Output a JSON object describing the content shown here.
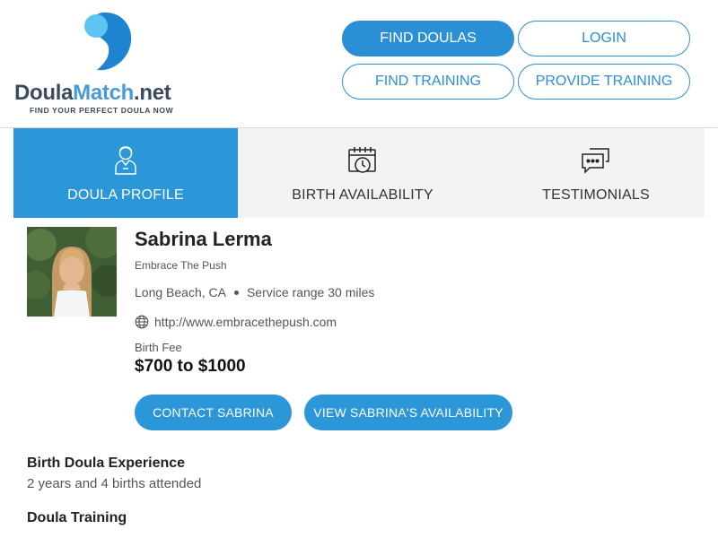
{
  "brand": {
    "name_part1": "Doula",
    "name_part2": "Match",
    "name_part3": ".net",
    "tagline": "FIND YOUR PERFECT DOULA NOW",
    "colors": {
      "primary": "#2b96d8",
      "logo_light": "#5ec4f2",
      "logo_dark": "#1f84d0",
      "text_dark": "#3b4a5c"
    }
  },
  "nav": {
    "find_doulas": "FIND DOULAS",
    "login": "LOGIN",
    "find_training": "FIND TRAINING",
    "provide_training": "PROVIDE TRAINING"
  },
  "tabs": [
    {
      "label": "DOULA PROFILE",
      "icon": "doula-person-icon",
      "active": true
    },
    {
      "label": "BIRTH AVAILABILITY",
      "icon": "calendar-clock-icon",
      "active": false
    },
    {
      "label": "TESTIMONIALS",
      "icon": "chat-bubbles-icon",
      "active": false
    }
  ],
  "profile": {
    "name": "Sabrina Lerma",
    "company": "Embrace The Push",
    "location": "Long Beach, CA",
    "service_range": "Service range 30 miles",
    "website": "http://www.embracethepush.com",
    "fee_label": "Birth Fee",
    "fee_value": "$700 to $1000",
    "contact_button": "CONTACT SABRINA",
    "availability_button": "VIEW SABRINA'S AVAILABILITY"
  },
  "sections": {
    "experience_title": "Birth Doula Experience",
    "experience_body": "2 years and 4 births attended",
    "training_title": "Doula Training"
  }
}
